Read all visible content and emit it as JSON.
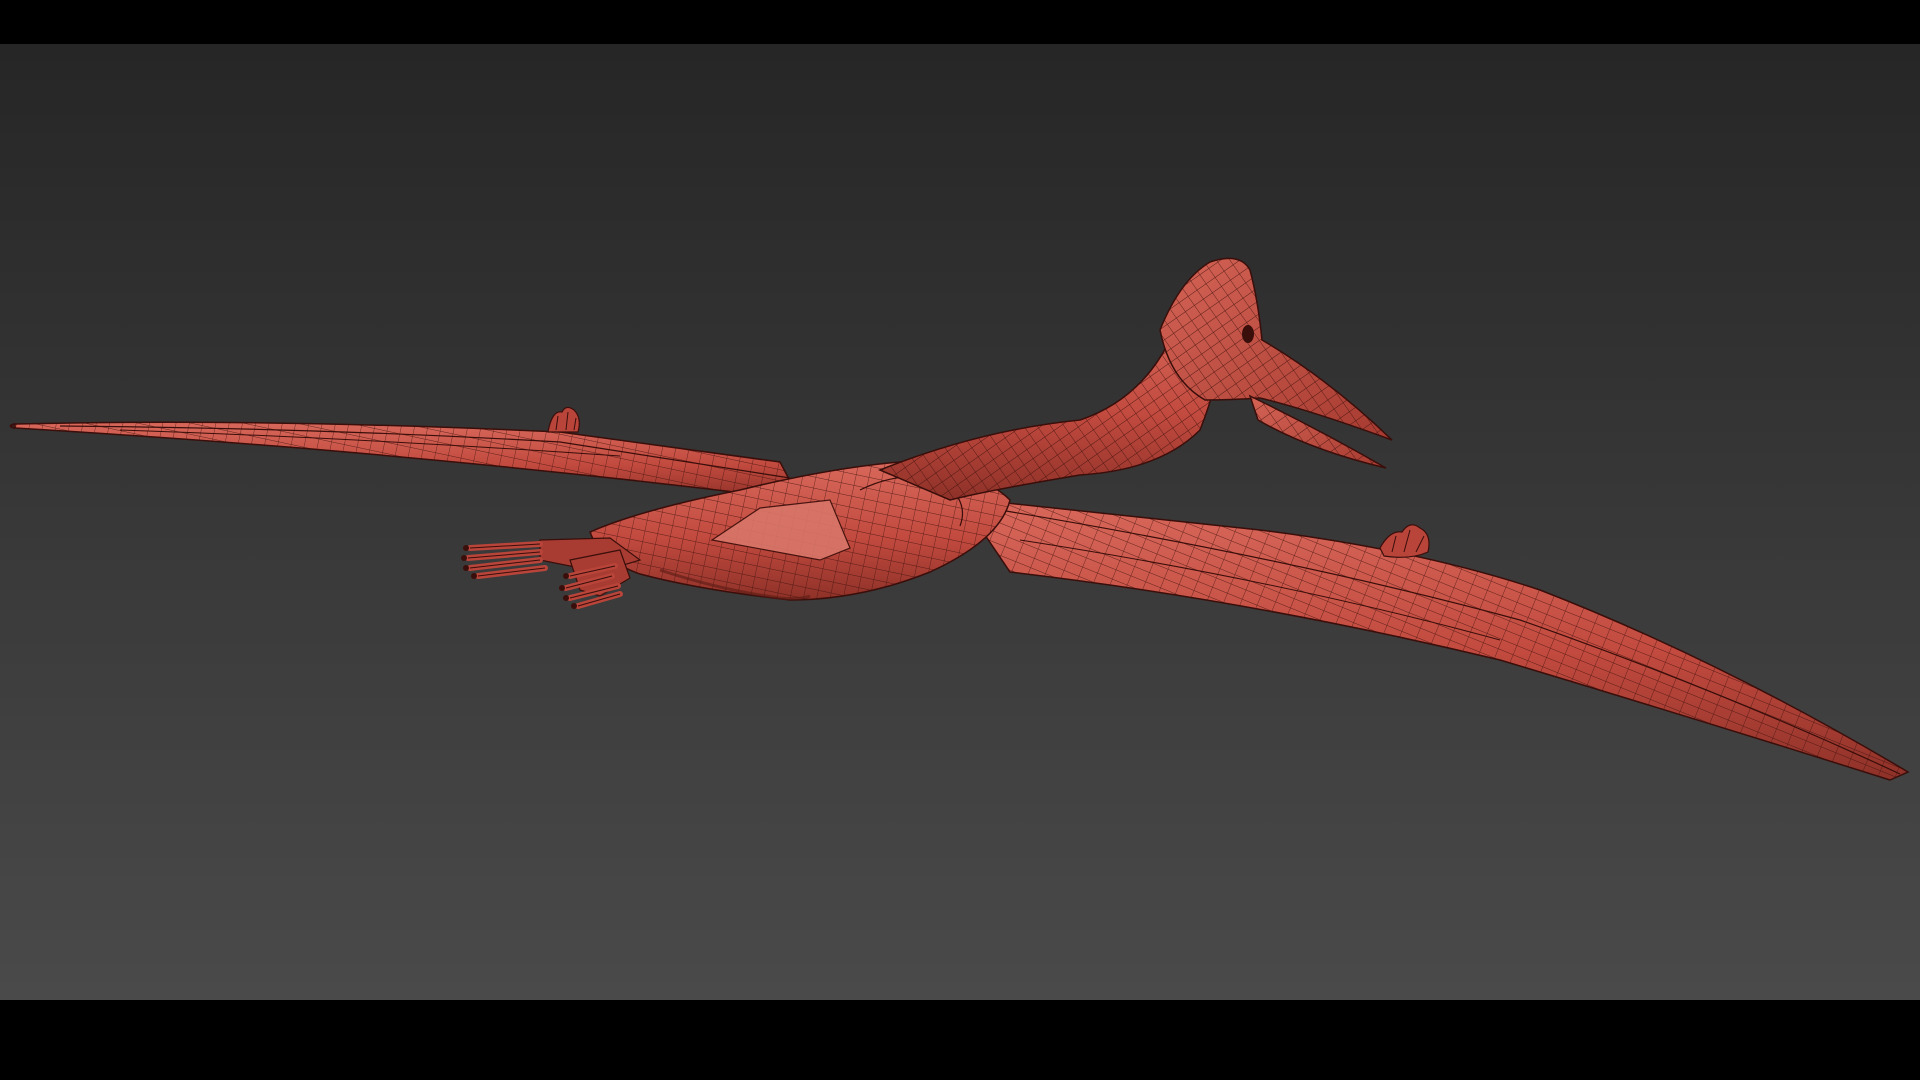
{
  "scene": {
    "subject": "pterosaur-wireframe-mesh",
    "shading": "solid-with-edged-faces",
    "colors": {
      "background_top": "#262626",
      "background_bottom": "#4a4a4a",
      "mesh_fill": "#c24a3f",
      "mesh_highlight": "#d8685b",
      "mesh_shadow": "#7a2a22",
      "wire": "#3a0e0a",
      "letterbox": "#000000"
    }
  }
}
